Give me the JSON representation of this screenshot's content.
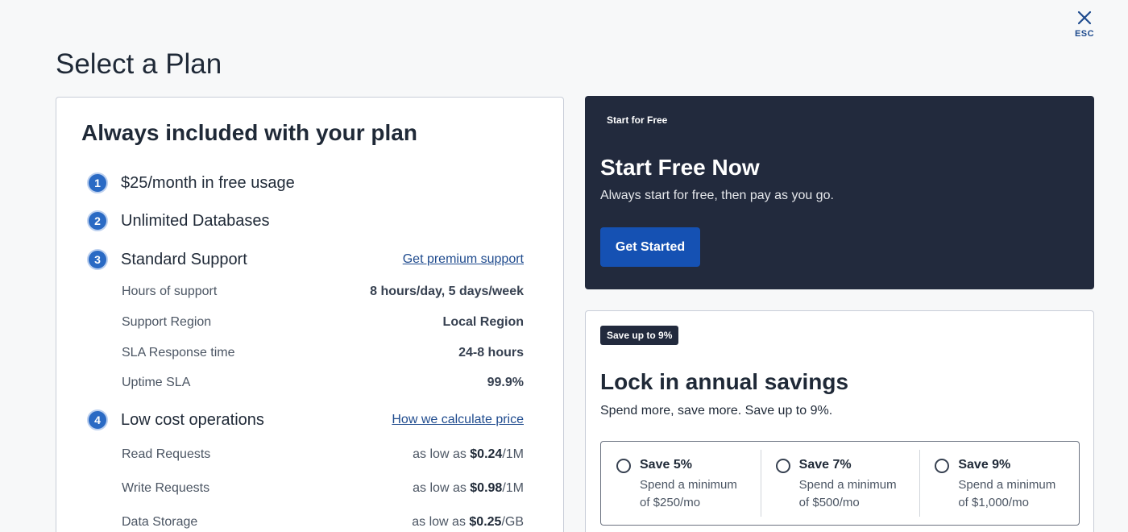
{
  "close": {
    "label": "ESC"
  },
  "page_title": "Select a Plan",
  "included": {
    "title": "Always included with your plan",
    "features": [
      {
        "num": "1",
        "label": "$25/month in free usage"
      },
      {
        "num": "2",
        "label": "Unlimited Databases"
      },
      {
        "num": "3",
        "label": "Standard Support",
        "link": "Get premium support"
      },
      {
        "num": "4",
        "label": "Low cost operations",
        "link": "How we calculate price"
      }
    ],
    "support_details": [
      {
        "label": "Hours of support",
        "value": "8 hours/day, 5 days/week"
      },
      {
        "label": "Support Region",
        "value": "Local Region"
      },
      {
        "label": "SLA Response time",
        "value": "24-8 hours"
      },
      {
        "label": "Uptime SLA",
        "value": "99.9%"
      }
    ],
    "pricing": [
      {
        "label": "Read Requests",
        "prefix": "as low as ",
        "price": "$0.24",
        "unit": "/1M"
      },
      {
        "label": "Write Requests",
        "prefix": "as low as ",
        "price": "$0.98",
        "unit": "/1M"
      },
      {
        "label": "Data Storage",
        "prefix": "as low as ",
        "price": "$0.25",
        "unit": "/GB"
      }
    ]
  },
  "free": {
    "tag": "Start for Free",
    "title": "Start Free Now",
    "subtitle": "Always start for free, then pay as you go.",
    "button": "Get Started"
  },
  "savings": {
    "badge": "Save up to 9%",
    "title": "Lock in annual savings",
    "subtitle": "Spend more, save more. Save up to 9%.",
    "options": [
      {
        "title": "Save 5%",
        "desc": "Spend a minimum of $250/mo"
      },
      {
        "title": "Save 7%",
        "desc": "Spend a minimum of $500/mo"
      },
      {
        "title": "Save 9%",
        "desc": "Spend a minimum of $1,000/mo"
      }
    ]
  },
  "colors": {
    "background": "#f7f8f9",
    "dark_card": "#222a3d",
    "primary_button": "#1551b3",
    "link": "#1f4b8e",
    "badge_blue": "#2a6ac4"
  }
}
